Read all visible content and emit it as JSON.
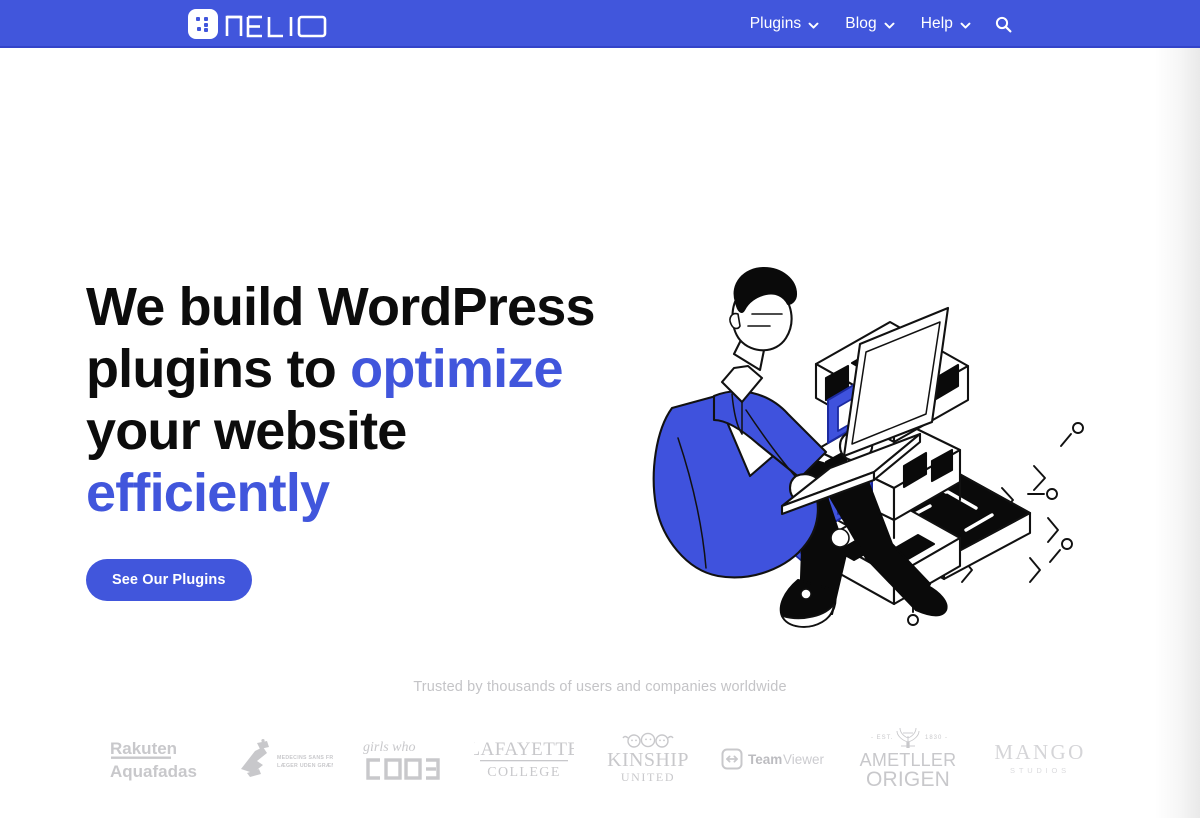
{
  "site": {
    "brand_name": "NELIO",
    "brand_icon": "nelio-dots-logo",
    "header_color": "#4156DC",
    "accent_color": "#4156DC",
    "heading_color": "#0c0c0c",
    "muted_color": "#c4c4c7"
  },
  "nav": {
    "items": [
      {
        "label": "Plugins",
        "has_dropdown": true,
        "icon": "chevron-down-icon"
      },
      {
        "label": "Blog",
        "has_dropdown": true,
        "icon": "chevron-down-icon"
      },
      {
        "label": "Help",
        "has_dropdown": true,
        "icon": "chevron-down-icon"
      }
    ],
    "search_icon": "search-icon"
  },
  "hero": {
    "headline_line1": "We build WordPress",
    "headline_line2_plain": "plugins to ",
    "headline_line2_accent": "optimize",
    "headline_line3": "your website",
    "headline_line4_accent": "efficiently",
    "cta_label": "See Our Plugins",
    "illustration_name": "developer-with-laptop-isometric-blocks"
  },
  "trusted": {
    "caption": "Trusted by thousands of users and companies worldwide",
    "logos": [
      {
        "name": "rakuten-aquafadas-logo",
        "line1": "Rakuten",
        "line2": "Aquafadas"
      },
      {
        "name": "medecins-sans-frontieres-logo",
        "line1": "MEDECINS SANS FRONTIERES",
        "line2": "LÆGER UDEN GRÆNSER"
      },
      {
        "name": "girls-who-code-logo",
        "line1": "girls who",
        "line2": "CODE"
      },
      {
        "name": "lafayette-college-logo",
        "line1": "LAFAYETTE",
        "line2": "COLLEGE"
      },
      {
        "name": "kinship-united-logo",
        "line1": "KINSHIP",
        "line2": "UNITED"
      },
      {
        "name": "teamviewer-logo",
        "line1": "Team",
        "line2": "Viewer"
      },
      {
        "name": "ametller-origen-logo",
        "line1": "AMETLLER",
        "line2": "ORIGEN",
        "line3": "EST.",
        "line4": "1830"
      },
      {
        "name": "mango-studios-logo",
        "line1": "MANGO",
        "line2": "S T U D I O S"
      }
    ]
  }
}
